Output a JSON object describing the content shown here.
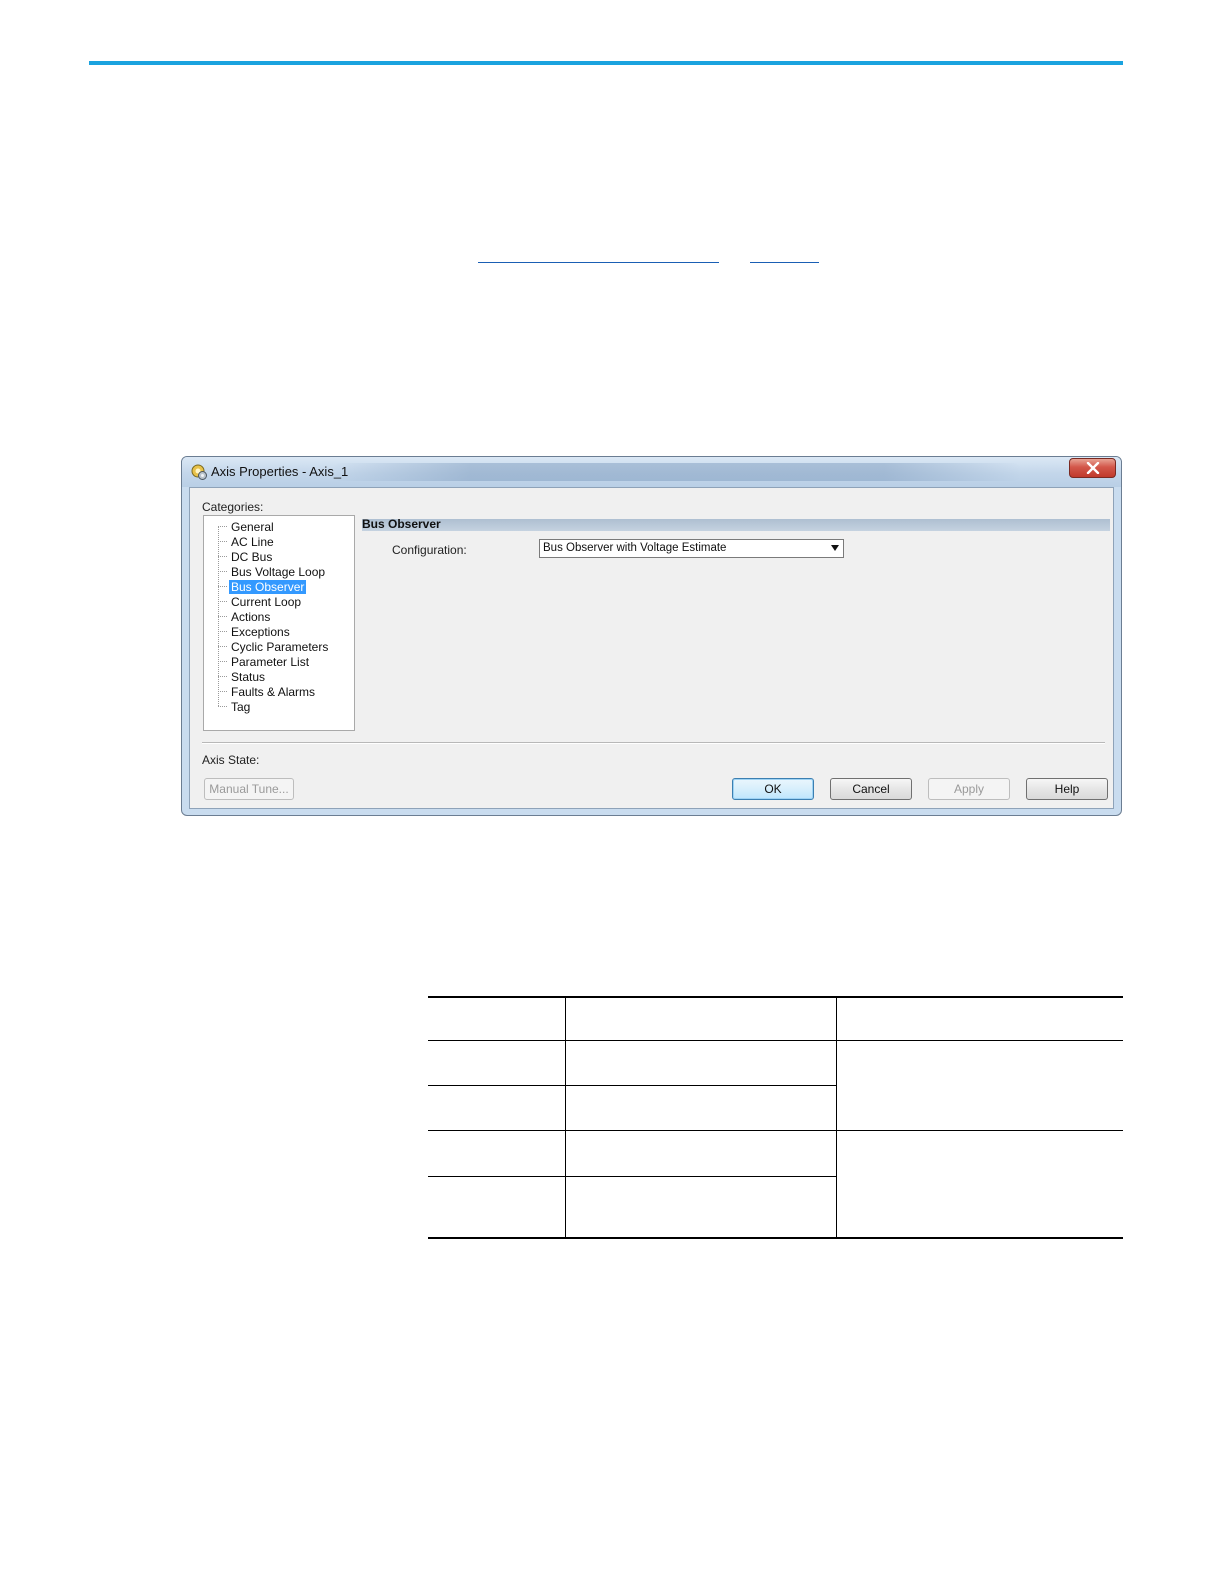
{
  "dialog": {
    "title": "Axis Properties - Axis_1",
    "categories_label": "Categories:",
    "categories": [
      "General",
      "AC Line",
      "DC Bus",
      "Bus Voltage Loop",
      "Bus Observer",
      "Current Loop",
      "Actions",
      "Exceptions",
      "Cyclic Parameters",
      "Parameter List",
      "Status",
      "Faults & Alarms",
      "Tag"
    ],
    "selected_category": "Bus Observer",
    "section_title": "Bus Observer",
    "configuration_label": "Configuration:",
    "configuration_value": "Bus Observer with Voltage Estimate",
    "axis_state_label": "Axis State:",
    "buttons": {
      "manual_tune": "Manual Tune...",
      "ok": "OK",
      "cancel": "Cancel",
      "apply": "Apply",
      "help": "Help"
    }
  },
  "colors": {
    "accent_rule": "#1aa3df",
    "selection": "#3399ff",
    "close_button": "#c0392b"
  }
}
